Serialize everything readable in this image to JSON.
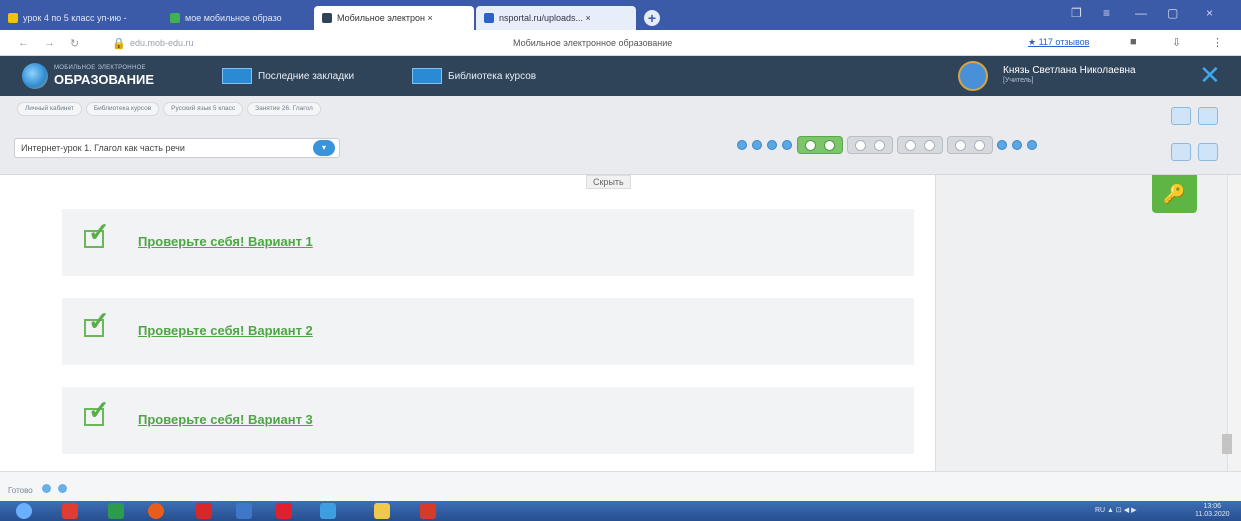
{
  "browser": {
    "tabs": [
      {
        "label": "урок 4 по 5 класс уп-ию - ",
        "favicon_color": "#f0c400"
      },
      {
        "label": "мое мобильное образо",
        "favicon_color": "#3fb34f"
      },
      {
        "label": "Мобильное электрон  ×",
        "favicon_color": "#2f4359"
      },
      {
        "label": "nsportal.ru/uploads... ×",
        "favicon_color": "#2a62c9"
      }
    ],
    "new_tab": "+",
    "window_controls": [
      "❐",
      "≡",
      "—",
      "▢",
      "×"
    ],
    "url": "edu.mob-edu.ru",
    "page_title": "Мобильное электронное образование",
    "rating_link": "★ 117 отзывов"
  },
  "site": {
    "logo_small": "МОБИЛЬНОЕ ЭЛЕКТРОННОЕ",
    "logo_big": "ОБРАЗОВАНИЕ",
    "nav_recent": "Последние закладки",
    "nav_library": "Библиотека курсов",
    "user_name": "Князь Светлана Николаевна",
    "user_role": "[Учитель]",
    "close": "✕"
  },
  "toolbar": {
    "breadcrumbs": [
      "Личный кабинет",
      "Библиотека курсов",
      "Русский язык 5 класс",
      "Занятие 26. Глагол"
    ],
    "lesson_select": "Интернет-урок 1. Глагол как часть речи",
    "select_arrow": "▾"
  },
  "main": {
    "hide_button": "Скрыть",
    "check_cards": [
      {
        "label": "Проверьте себя! Вариант 1"
      },
      {
        "label": "Проверьте себя! Вариант 2"
      },
      {
        "label": "Проверьте себя! Вариант 3"
      }
    ],
    "key_icon": "🔑"
  },
  "statusbar": {
    "text": "Готово"
  },
  "taskbar": {
    "clock_time": "13:06",
    "clock_date": "11.03.2020",
    "tray": "RU ▲ ⊡ ◀ ▶"
  }
}
